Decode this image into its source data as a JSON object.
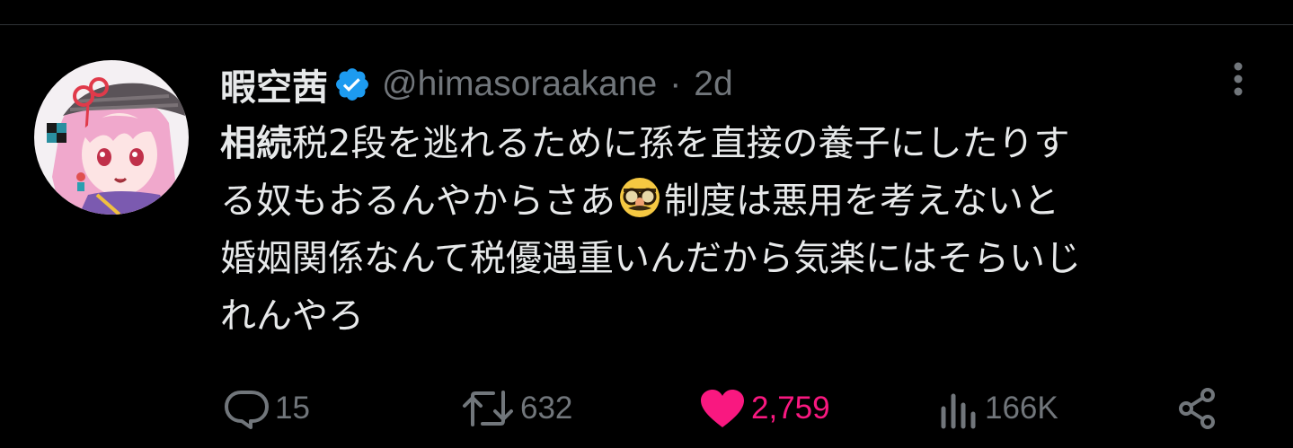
{
  "tweet": {
    "display_name": "暇空茜",
    "handle": "@himasoraakane",
    "separator": "·",
    "time": "2d",
    "text_lines": [
      {
        "bold": "相続",
        "rest": "税2段を逃れるために孫を直接の養子にしたりす"
      },
      {
        "before_emoji": "る奴もおるんやからさあ",
        "emoji": "disguised-face-emoji",
        "after_emoji": "制度は悪用を考えないと"
      },
      {
        "text": "婚姻関係なんて税優遇重いんだから気楽にはそらいじ"
      },
      {
        "text": "れんやろ"
      }
    ]
  },
  "actions": {
    "replies": "15",
    "retweets": "632",
    "likes": "2,759",
    "views": "166K"
  },
  "icons": {
    "verified": "verified-badge-icon",
    "more": "more-vertical-icon",
    "reply": "reply-icon",
    "retweet": "retweet-icon",
    "like": "heart-icon",
    "views": "views-icon",
    "share": "share-icon"
  },
  "colors": {
    "background": "#000000",
    "text": "#e7e9ea",
    "secondary": "#71767b",
    "verified": "#1d9bf0",
    "like": "#f91880"
  }
}
